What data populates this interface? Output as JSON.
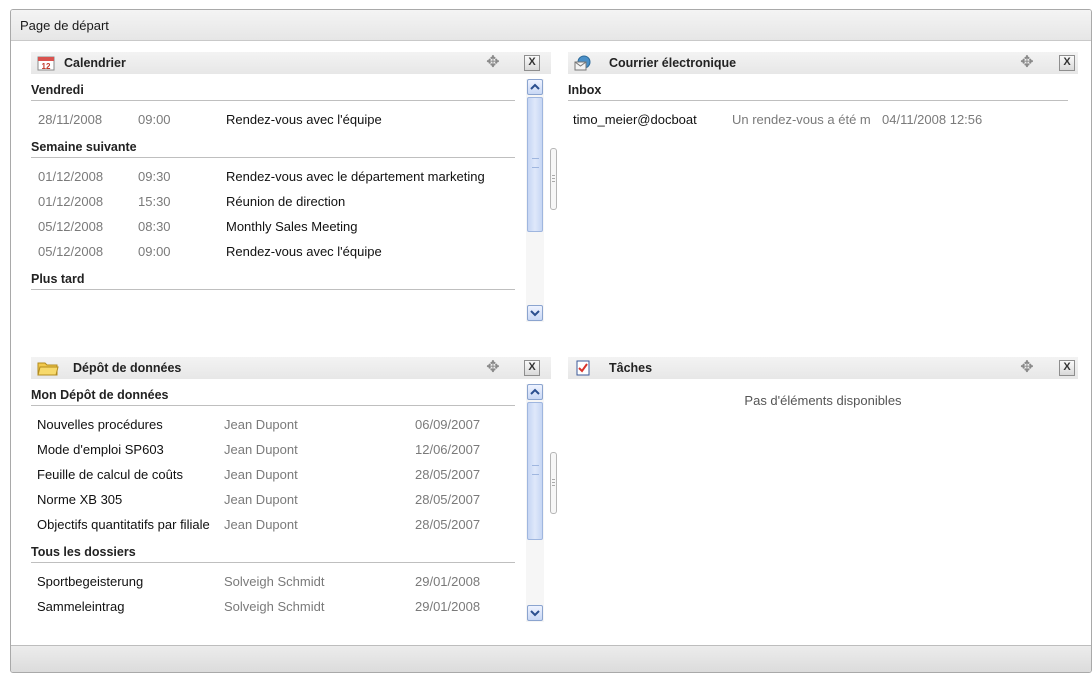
{
  "page": {
    "title": "Page de départ"
  },
  "calendar": {
    "title": "Calendrier",
    "close_label": "X",
    "groups": [
      {
        "label": "Vendredi",
        "rows": [
          {
            "date": "28/11/2008",
            "time": "09:00",
            "subject": "Rendez-vous avec l'équipe"
          }
        ]
      },
      {
        "label": "Semaine suivante",
        "rows": [
          {
            "date": "01/12/2008",
            "time": "09:30",
            "subject": "Rendez-vous avec le département marketing"
          },
          {
            "date": "01/12/2008",
            "time": "15:30",
            "subject": "Réunion de direction"
          },
          {
            "date": "05/12/2008",
            "time": "08:30",
            "subject": "Monthly Sales Meeting"
          },
          {
            "date": "05/12/2008",
            "time": "09:00",
            "subject": "Rendez-vous avec l'équipe"
          }
        ]
      },
      {
        "label": "Plus tard",
        "rows": []
      }
    ]
  },
  "mail": {
    "title": "Courrier électronique",
    "close_label": "X",
    "folder": "Inbox",
    "rows": [
      {
        "from": "timo_meier@docboat",
        "subject": "Un rendez-vous a été m",
        "date": "04/11/2008 12:56"
      }
    ]
  },
  "datastore": {
    "title": "Dépôt de données",
    "close_label": "X",
    "groups": [
      {
        "label": "Mon Dépôt de données",
        "rows": [
          {
            "name": "Nouvelles procédures",
            "author": "Jean Dupont",
            "date": "06/09/2007"
          },
          {
            "name": "Mode d'emploi SP603",
            "author": "Jean Dupont",
            "date": "12/06/2007"
          },
          {
            "name": "Feuille de calcul de coûts",
            "author": "Jean Dupont",
            "date": "28/05/2007"
          },
          {
            "name": "Norme XB 305",
            "author": "Jean Dupont",
            "date": "28/05/2007"
          },
          {
            "name": "Objectifs quantitatifs par filiale",
            "author": "Jean Dupont",
            "date": "28/05/2007"
          }
        ]
      },
      {
        "label": "Tous les dossiers",
        "rows": [
          {
            "name": "Sportbegeisterung",
            "author": "Solveigh Schmidt",
            "date": "29/01/2008"
          },
          {
            "name": "Sammeleintrag",
            "author": "Solveigh Schmidt",
            "date": "29/01/2008"
          }
        ]
      }
    ]
  },
  "tasks": {
    "title": "Tâches",
    "close_label": "X",
    "empty_message": "Pas d'éléments disponibles"
  },
  "icons": {
    "calendar": "calendar-icon",
    "mail": "mail-icon",
    "datastore": "folder-icon",
    "tasks": "task-checklist-icon",
    "move": "move-icon",
    "close": "close-icon"
  }
}
